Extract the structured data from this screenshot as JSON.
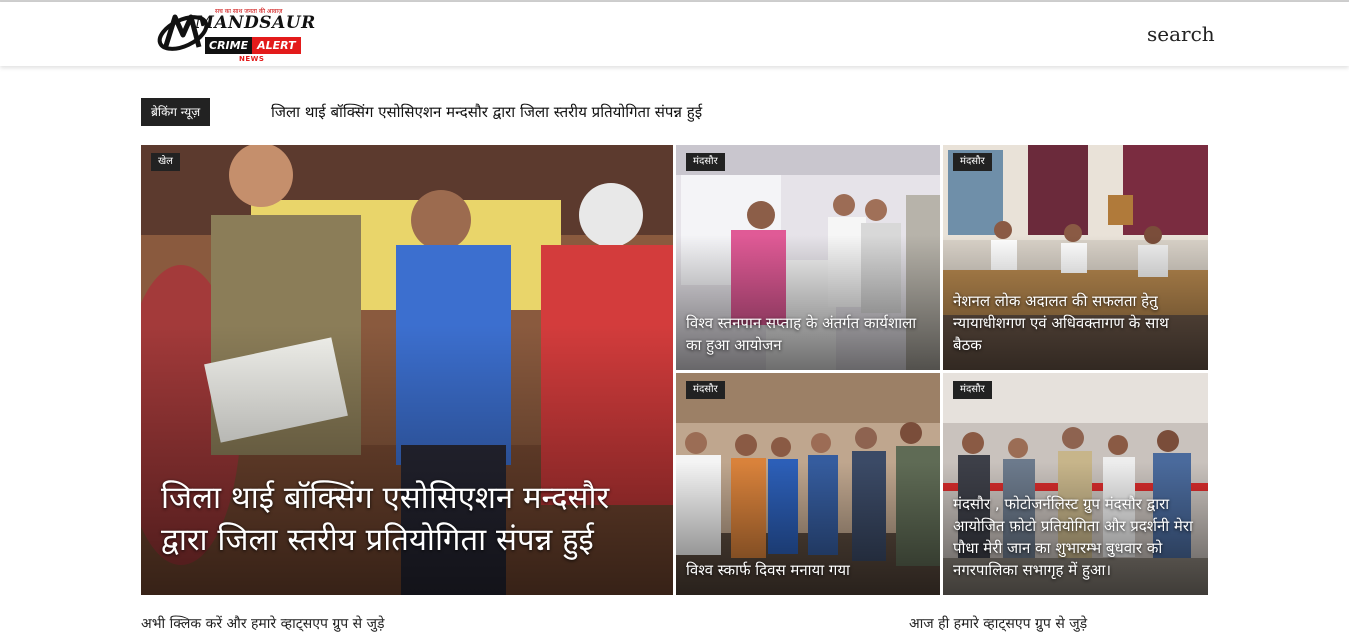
{
  "header": {
    "logo": {
      "brand_top": "MANDSAUR",
      "brand_mid": "CRIME",
      "brand_mid2": "ALERT",
      "brand_bottom": "NEWS",
      "tagline": "सच का साथ जनता की आवाज़"
    },
    "search_label": "search"
  },
  "breaking": {
    "label": "ब्रेकिंग न्यूज़",
    "headline": "जिला थाई बॉक्सिंग एसोसिएशन मन्दसौर द्वारा जिला स्तरीय प्रतियोगिता संपन्न हुई"
  },
  "featured": {
    "category": "खेल",
    "title": "जिला थाई बॉक्सिंग एसोसिएशन मन्दसौर द्वारा जिला स्तरीय प्रतियोगिता संपन्न हुई"
  },
  "cards": [
    {
      "category": "मंदसौर",
      "title": "विश्व स्तनपान सप्ताह के अंतर्गत कार्यशाला का हुआ आयोजन"
    },
    {
      "category": "मंदसौर",
      "title": "नेशनल लोक अदालत की सफलता हेतु न्यायाधीशगण एवं अधिवक्तागण के साथ बैठक"
    },
    {
      "category": "मंदसौर",
      "title": "विश्व स्कार्फ दिवस मनाया गया"
    },
    {
      "category": "मंदसौर",
      "title": "मंदसौर , फोटोजर्नलिस्ट ग्रुप मंदसौर द्वारा आयोजित फ़ोटो प्रतियोगिता और प्रदर्शनी मेरा पौधा मेरी जान का शुभारम्भ बुधवार को नगरपालिका सभागृह में हुआ।"
    }
  ],
  "footer_links": {
    "left": "अभी क्लिक करें और हमारे व्हाट्सएप ग्रुप से जुड़े",
    "right": "आज ही हमारे व्हाट्सएप ग्रुप से जुड़े"
  },
  "colors": {
    "label_bg": "#222222",
    "accent_red": "#e31b1b",
    "text": "#111111"
  }
}
